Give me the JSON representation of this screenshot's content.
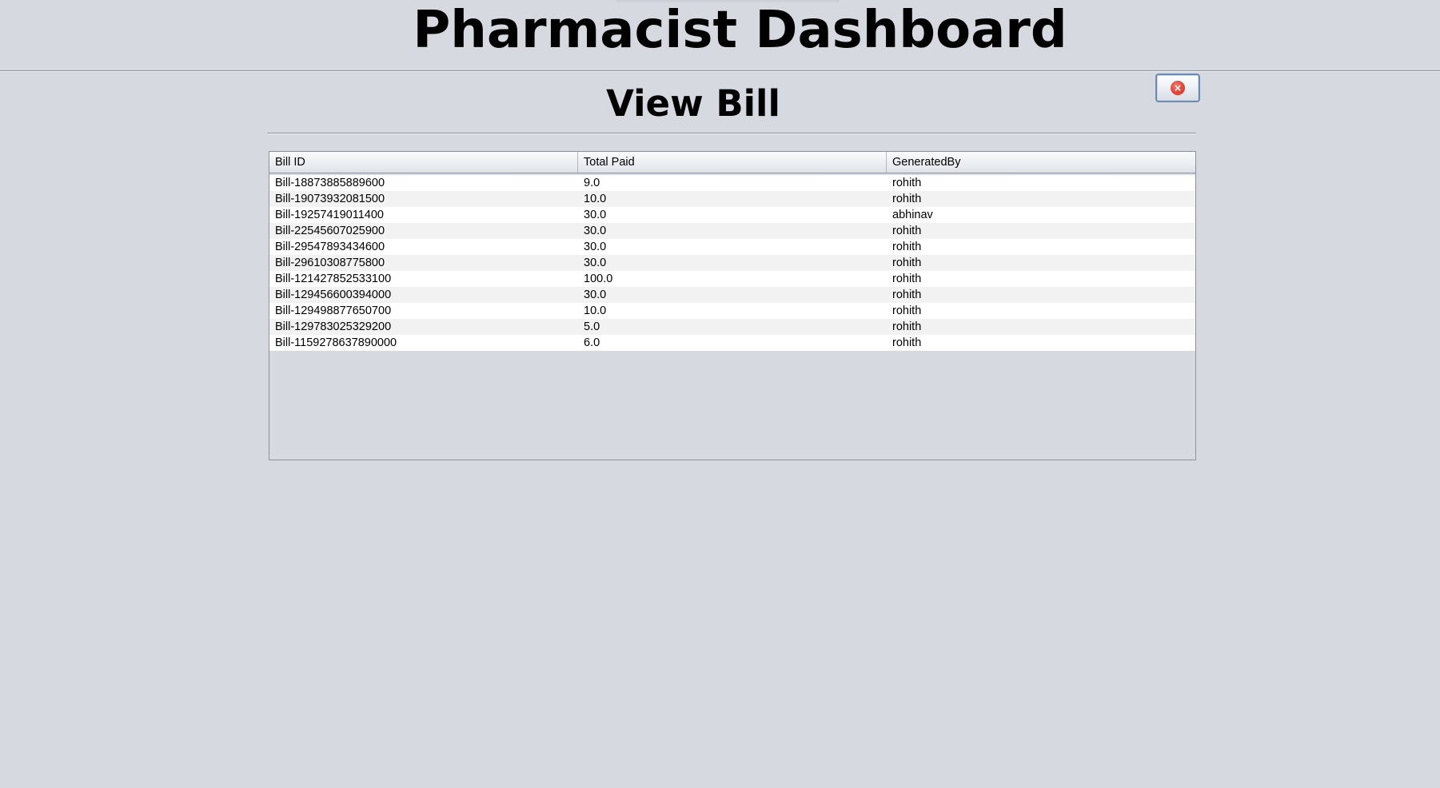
{
  "header": {
    "title": "Pharmacist Dashboard"
  },
  "panel": {
    "title": "View Bill",
    "close_button": {
      "icon": "close-icon",
      "glyph": "×",
      "color": "#e0453a"
    }
  },
  "table": {
    "columns": [
      "Bill ID",
      "Total Paid",
      "GeneratedBy"
    ],
    "rows": [
      [
        "Bill-18873885889600",
        "9.0",
        "rohith"
      ],
      [
        "Bill-19073932081500",
        "10.0",
        "rohith"
      ],
      [
        "Bill-19257419011400",
        "30.0",
        "abhinav"
      ],
      [
        "Bill-22545607025900",
        "30.0",
        "rohith"
      ],
      [
        "Bill-29547893434600",
        "30.0",
        "rohith"
      ],
      [
        "Bill-29610308775800",
        "30.0",
        "rohith"
      ],
      [
        "Bill-121427852533100",
        "100.0",
        "rohith"
      ],
      [
        "Bill-129456600394000",
        "30.0",
        "rohith"
      ],
      [
        "Bill-129498877650700",
        "10.0",
        "rohith"
      ],
      [
        "Bill-129783025329200",
        "5.0",
        "rohith"
      ],
      [
        "Bill-1159278637890000",
        "6.0",
        "rohith"
      ]
    ]
  },
  "colors": {
    "background": "#d6d9e0",
    "row_odd": "#ffffff",
    "row_even": "#f2f2f2",
    "button_border": "#6d8bb0"
  }
}
